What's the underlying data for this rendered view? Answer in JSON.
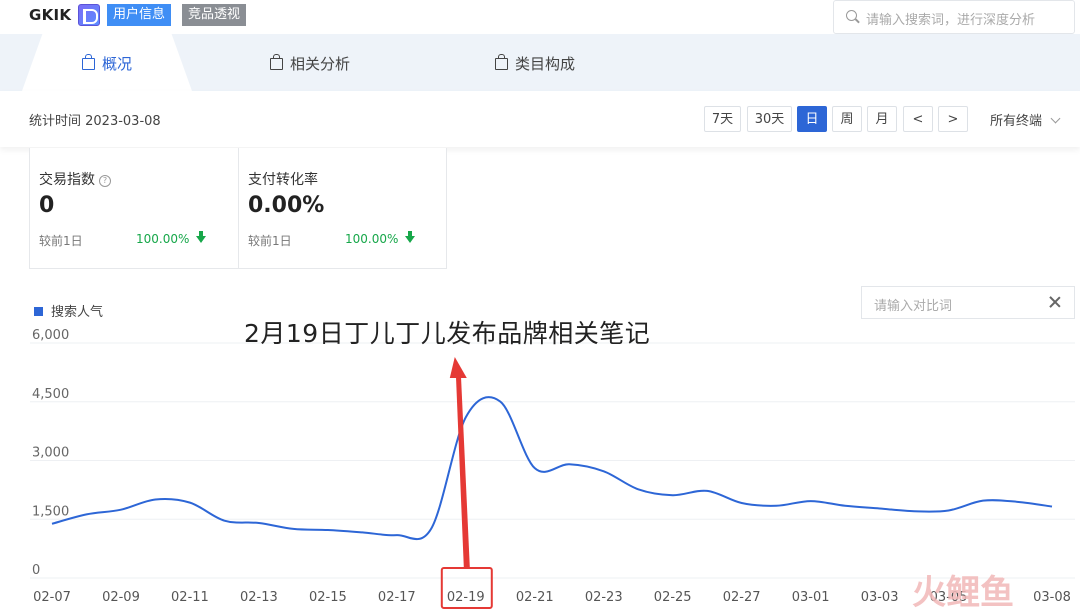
{
  "header": {
    "brand": "GKIK",
    "tag_user": "用户信息",
    "tag_competitor": "竞品透视",
    "search_placeholder": "请输入搜索词，进行深度分析"
  },
  "tabs": [
    {
      "label": "概况",
      "active": true
    },
    {
      "label": "相关分析",
      "active": false
    },
    {
      "label": "类目构成",
      "active": false
    }
  ],
  "toolbar": {
    "stat_time": "统计时间 2023-03-08",
    "ranges": [
      "7天",
      "30天",
      "日",
      "周",
      "月"
    ],
    "active_range": "日",
    "prev": "<",
    "next": ">",
    "terminal": "所有终端"
  },
  "cards": [
    {
      "title": "交易指数",
      "has_help": true,
      "help": "?",
      "value": "0",
      "compare_label": "较前1日",
      "compare_value": "100.00%"
    },
    {
      "title": "支付转化率",
      "has_help": false,
      "value": "0.00%",
      "compare_label": "较前1日",
      "compare_value": "100.00%"
    }
  ],
  "chart_panel": {
    "legend": "搜索人气",
    "compare_placeholder": "请输入对比词",
    "annotation": "2月19日丁儿丁儿发布品牌相关笔记"
  },
  "colors": {
    "accent": "#2d66d6",
    "up_down_green": "#17a74a",
    "highlight_red": "#e53935"
  },
  "chart_data": {
    "type": "line",
    "title": "",
    "xlabel": "",
    "ylabel": "",
    "ylim": [
      0,
      6000
    ],
    "yticks": [
      "6,000",
      "4,500",
      "3,000",
      "1,500",
      "0"
    ],
    "ytick_values": [
      6000,
      4500,
      3000,
      1500,
      0
    ],
    "x": [
      "02-07",
      "02-08",
      "02-09",
      "02-10",
      "02-11",
      "02-12",
      "02-13",
      "02-14",
      "02-15",
      "02-16",
      "02-17",
      "02-18",
      "02-19",
      "02-20",
      "02-21",
      "02-22",
      "02-23",
      "02-24",
      "02-25",
      "02-26",
      "02-27",
      "02-28",
      "03-01",
      "03-02",
      "03-03",
      "03-04",
      "03-05",
      "03-06",
      "03-07",
      "03-08"
    ],
    "xtick_labels": [
      "02-07",
      "02-09",
      "02-11",
      "02-13",
      "02-15",
      "02-17",
      "02-19",
      "02-21",
      "02-23",
      "02-25",
      "02-27",
      "03-01",
      "03-03",
      "03-05",
      "03-08"
    ],
    "highlight_x": "02-19",
    "series": [
      {
        "name": "搜索人气",
        "color": "#2d66d6",
        "values": [
          1180,
          1420,
          1540,
          1800,
          1720,
          1260,
          1200,
          1050,
          1020,
          960,
          890,
          1060,
          3900,
          4300,
          2600,
          2700,
          2520,
          2060,
          1910,
          2020,
          1710,
          1640,
          1760,
          1640,
          1570,
          1500,
          1520,
          1770,
          1740,
          1620
        ]
      }
    ]
  },
  "watermark": {
    "text": "火鲤鱼"
  }
}
